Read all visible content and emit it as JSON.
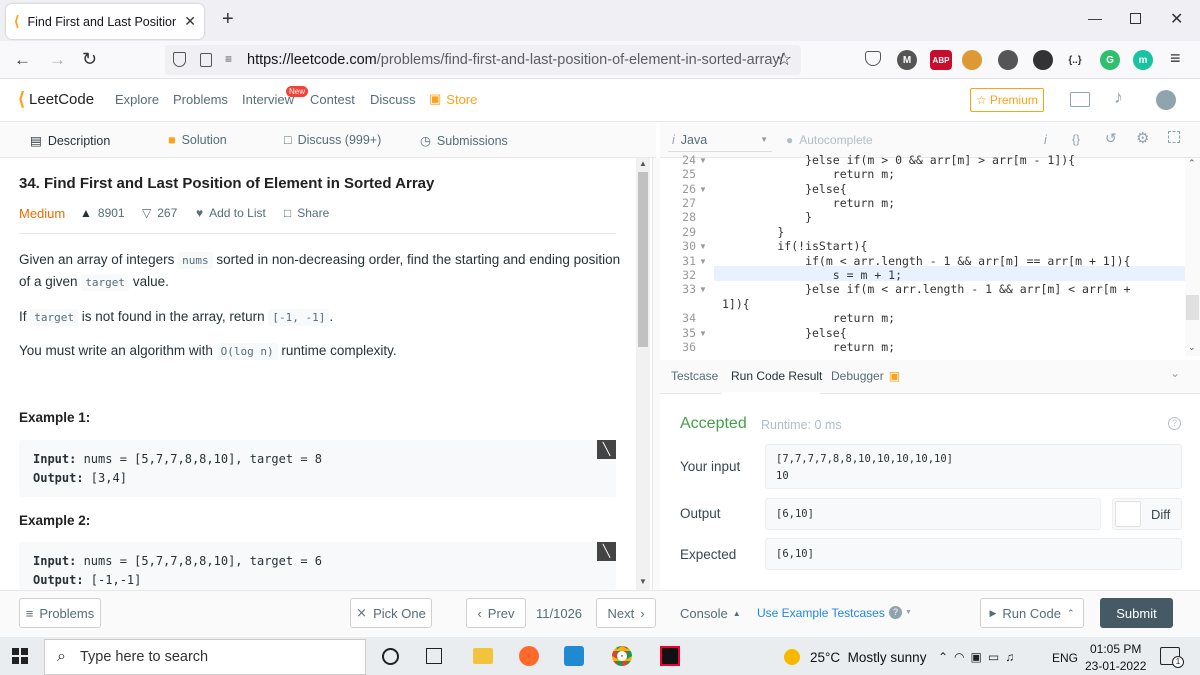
{
  "browser": {
    "tab_title": "Find First and Last Position of El",
    "new_tab": "+",
    "url_domain": "https://leetcode.com",
    "url_path": "/problems/find-first-and-last-position-of-element-in-sorted-array/",
    "extensions": [
      {
        "name": "M",
        "color": "#555"
      },
      {
        "name": "ABP",
        "color": "#c70d2c"
      },
      {
        "name": "",
        "color": "#d93"
      },
      {
        "name": "",
        "color": "#555"
      },
      {
        "name": "",
        "color": "#333"
      },
      {
        "name": "{..}",
        "color": "#333"
      },
      {
        "name": "G",
        "color": "#2fbf6f"
      },
      {
        "name": "m",
        "color": "#19c2a0"
      }
    ]
  },
  "nav": {
    "logo": "LeetCode",
    "explore": "Explore",
    "problems": "Problems",
    "interview": "Interview",
    "new_badge": "New",
    "contest": "Contest",
    "discuss": "Discuss",
    "store": "Store",
    "premium": "Premium"
  },
  "left_tabs": {
    "description": "Description",
    "solution": "Solution",
    "discuss": "Discuss (999+)",
    "submissions": "Submissions"
  },
  "problem": {
    "title": "34. Find First and Last Position of Element in Sorted Array",
    "difficulty": "Medium",
    "likes": "8901",
    "dislikes": "267",
    "add_to_list": "Add to List",
    "share": "Share",
    "p1_a": "Given an array of integers",
    "p1_code1": "nums",
    "p1_b": "sorted in non-decreasing order, find the starting and ending position",
    "p1_c": "of a given",
    "p1_code2": "target",
    "p1_d": "value.",
    "p2_a": "If",
    "p2_code1": "target",
    "p2_b": "is not found in the array, return",
    "p2_code2": "[-1, -1]",
    "p2_c": ".",
    "p3_a": "You must write an algorithm with",
    "p3_code": "O(log n)",
    "p3_b": "runtime complexity.",
    "ex1_title": "Example 1:",
    "ex1_in_label": "Input:",
    "ex1_in": " nums = [5,7,7,8,8,10], target = 8",
    "ex1_out_label": "Output:",
    "ex1_out": " [3,4]",
    "ex2_title": "Example 2:",
    "ex2_in_label": "Input:",
    "ex2_in": " nums = [5,7,7,8,8,10], target = 6",
    "ex2_out_label": "Output:",
    "ex2_out": " [-1,-1]"
  },
  "editor": {
    "language": "Java",
    "autocomplete": "Autocomplete",
    "lines": [
      {
        "n": "24",
        "code": "            }else if(m > 0 && arr[m] > arr[m - 1]){"
      },
      {
        "n": "25",
        "code": "                return m;"
      },
      {
        "n": "26",
        "code": "            }else{"
      },
      {
        "n": "27",
        "code": "                return m;"
      },
      {
        "n": "28",
        "code": "            }"
      },
      {
        "n": "29",
        "code": "        }"
      },
      {
        "n": "30",
        "code": "        if(!isStart){"
      },
      {
        "n": "31",
        "code": "            if(m < arr.length - 1 && arr[m] == arr[m + 1]){"
      },
      {
        "n": "32",
        "code": "                s = m + 1;"
      },
      {
        "n": "33",
        "code": "            }else if(m < arr.length - 1 && arr[m] < arr[m +"
      },
      {
        "n": "",
        "code": "1]){"
      },
      {
        "n": "34",
        "code": "                return m;"
      },
      {
        "n": "35",
        "code": "            }else{"
      },
      {
        "n": "36",
        "code": "                return m;"
      }
    ]
  },
  "result": {
    "tab_testcase": "Testcase",
    "tab_run": "Run Code Result",
    "tab_debugger": "Debugger",
    "status": "Accepted",
    "runtime": "Runtime: 0 ms",
    "your_input_label": "Your input",
    "input_line1": "[7,7,7,7,8,8,10,10,10,10,10]",
    "input_line2": "10",
    "output_label": "Output",
    "output_value": "[6,10]",
    "diff": "Diff",
    "expected_label": "Expected",
    "expected_value": "[6,10]"
  },
  "footer": {
    "problems": "Problems",
    "pick_one": "Pick One",
    "prev": "Prev",
    "page": "11/1026",
    "next": "Next",
    "console": "Console",
    "use_example": "Use Example Testcases",
    "run_code": "Run Code",
    "submit": "Submit"
  },
  "taskbar": {
    "search_placeholder": "Type here to search",
    "weather": "25°C  Mostly sunny",
    "lang": "ENG",
    "time": "01:05 PM",
    "date": "23-01-2022",
    "notif": "1"
  }
}
